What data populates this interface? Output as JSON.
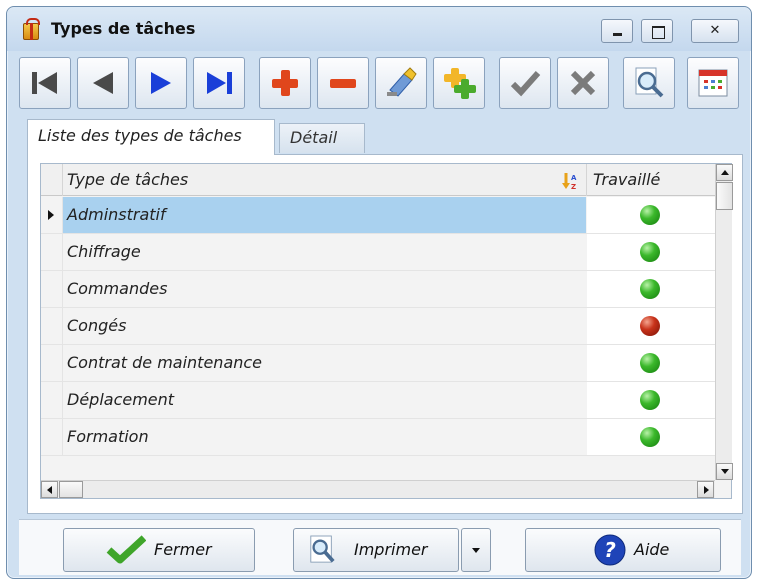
{
  "window": {
    "title": "Types de tâches",
    "icon": "gift-box-icon"
  },
  "window_controls": [
    "minimize",
    "maximize",
    "close"
  ],
  "toolbar": [
    {
      "name": "first-record",
      "icon": "first-record-icon"
    },
    {
      "name": "previous-record",
      "icon": "previous-record-icon"
    },
    {
      "name": "next-record",
      "icon": "next-record-icon"
    },
    {
      "name": "last-record",
      "icon": "last-record-icon"
    },
    {
      "name": "add",
      "icon": "plus-icon"
    },
    {
      "name": "delete",
      "icon": "minus-icon"
    },
    {
      "name": "edit",
      "icon": "brush-icon"
    },
    {
      "name": "duplicate",
      "icon": "duplicate-plus-icon"
    },
    {
      "name": "validate",
      "icon": "check-icon"
    },
    {
      "name": "cancel",
      "icon": "cross-icon"
    },
    {
      "name": "search",
      "icon": "magnifier-icon"
    },
    {
      "name": "calendar",
      "icon": "calendar-icon"
    }
  ],
  "tabs": [
    {
      "label": "Liste des types de tâches",
      "active": true
    },
    {
      "label": "Détail",
      "active": false
    }
  ],
  "grid": {
    "columns": [
      "Type de tâches",
      "Travaillé"
    ],
    "sort_icon": "sort-az-icon",
    "rows": [
      {
        "type": "Adminstratif",
        "travaille": "green",
        "selected": true
      },
      {
        "type": "Chiffrage",
        "travaille": "green",
        "selected": false
      },
      {
        "type": "Commandes",
        "travaille": "green",
        "selected": false
      },
      {
        "type": "Congés",
        "travaille": "red",
        "selected": false
      },
      {
        "type": "Contrat de maintenance",
        "travaille": "green",
        "selected": false
      },
      {
        "type": "Déplacement",
        "travaille": "green",
        "selected": false
      },
      {
        "type": "Formation",
        "travaille": "green",
        "selected": false
      }
    ]
  },
  "buttons": {
    "fermer": "Fermer",
    "imprimer": "Imprimer",
    "aide": "Aide"
  },
  "colors": {
    "selection": "#a9d1ef",
    "status_yes": "#3bb82b",
    "status_no": "#c8321a",
    "frame": "#cfe0f1"
  }
}
